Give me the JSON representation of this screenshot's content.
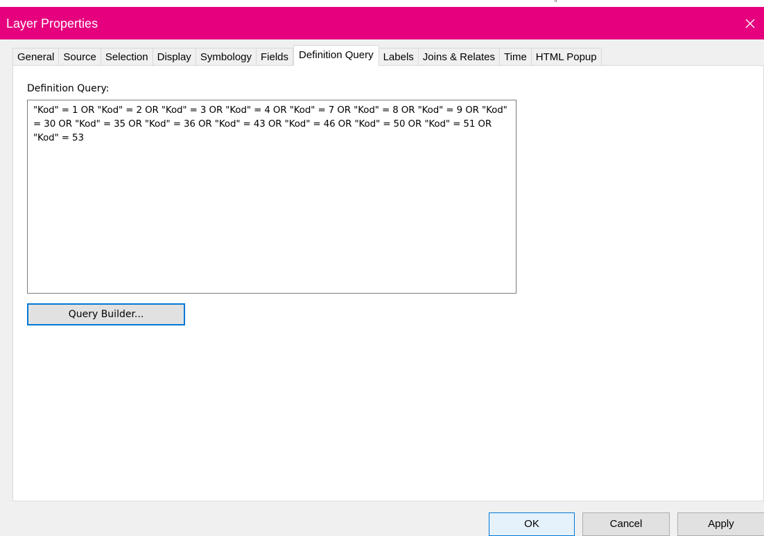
{
  "window": {
    "title": "Layer Properties",
    "top_mark": "\"",
    "accent_color": "#e6007e"
  },
  "tabs": [
    {
      "label": "General"
    },
    {
      "label": "Source"
    },
    {
      "label": "Selection"
    },
    {
      "label": "Display"
    },
    {
      "label": "Symbology"
    },
    {
      "label": "Fields"
    },
    {
      "label": "Definition Query",
      "active": true
    },
    {
      "label": "Labels"
    },
    {
      "label": "Joins & Relates"
    },
    {
      "label": "Time"
    },
    {
      "label": "HTML Popup"
    }
  ],
  "definition_query": {
    "label": "Definition Query:",
    "value": "\"Kod\" = 1 OR \"Kod\" = 2 OR \"Kod\" = 3 OR \"Kod\" = 4 OR \"Kod\" = 7 OR \"Kod\" = 8 OR \"Kod\" = 9 OR \"Kod\" = 30 OR \"Kod\" = 35 OR \"Kod\" = 36 OR \"Kod\" = 43 OR \"Kod\" = 46 OR \"Kod\" = 50 OR \"Kod\" = 51 OR \"Kod\" = 53",
    "query_builder_label": "Query Builder..."
  },
  "buttons": {
    "ok": "OK",
    "cancel": "Cancel",
    "apply": "Apply"
  }
}
